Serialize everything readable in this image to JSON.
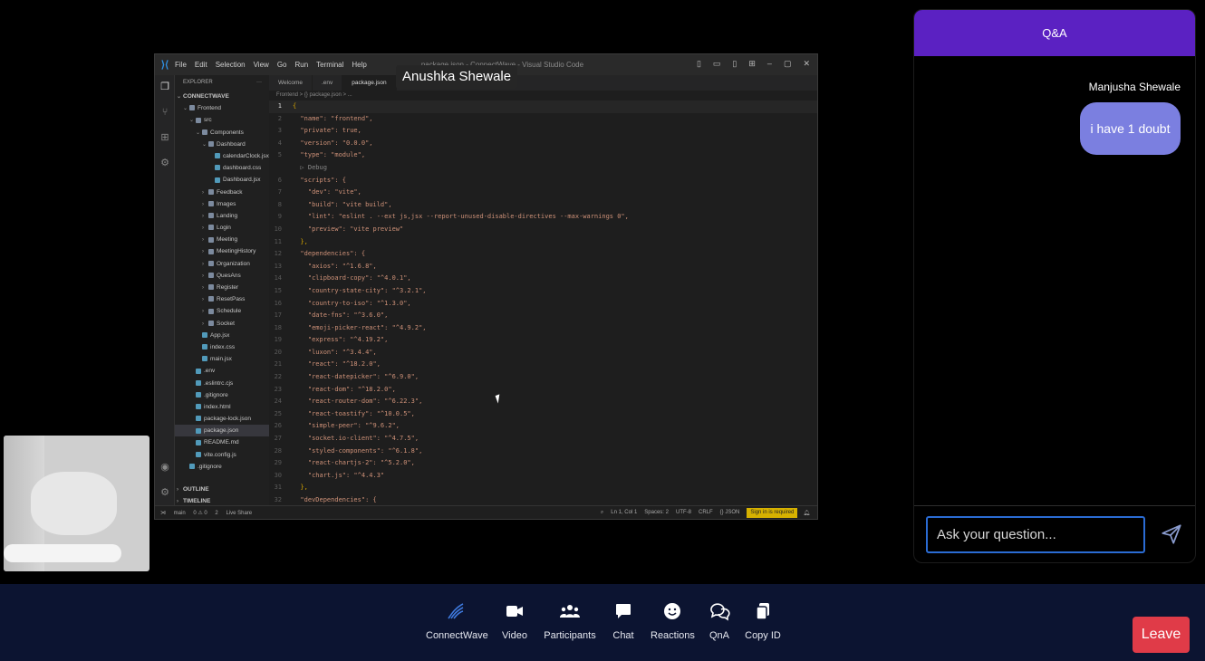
{
  "presenter": {
    "name": "Anushka Shewale"
  },
  "vscode": {
    "menu": [
      "File",
      "Edit",
      "Selection",
      "View",
      "Go",
      "Run",
      "Terminal",
      "Help"
    ],
    "window_title": "package.json - ConnectWave - Visual Studio Code",
    "explorer_title": "EXPLORER",
    "workspace": "CONNECTWAVE",
    "tree": [
      {
        "label": "Frontend",
        "depth": 1,
        "kind": "folder-open"
      },
      {
        "label": "src",
        "depth": 2,
        "kind": "folder-open"
      },
      {
        "label": "Components",
        "depth": 3,
        "kind": "folder-open"
      },
      {
        "label": "Dashboard",
        "depth": 4,
        "kind": "folder-open"
      },
      {
        "label": "calendarClock.jsx",
        "depth": 5,
        "kind": "file"
      },
      {
        "label": "dashboard.css",
        "depth": 5,
        "kind": "file"
      },
      {
        "label": "Dashboard.jsx",
        "depth": 5,
        "kind": "file"
      },
      {
        "label": "Feedback",
        "depth": 4,
        "kind": "folder"
      },
      {
        "label": "Images",
        "depth": 4,
        "kind": "folder"
      },
      {
        "label": "Landing",
        "depth": 4,
        "kind": "folder"
      },
      {
        "label": "Login",
        "depth": 4,
        "kind": "folder"
      },
      {
        "label": "Meeting",
        "depth": 4,
        "kind": "folder"
      },
      {
        "label": "MeetingHistory",
        "depth": 4,
        "kind": "folder"
      },
      {
        "label": "Organization",
        "depth": 4,
        "kind": "folder"
      },
      {
        "label": "QuesAns",
        "depth": 4,
        "kind": "folder"
      },
      {
        "label": "Register",
        "depth": 4,
        "kind": "folder"
      },
      {
        "label": "ResetPass",
        "depth": 4,
        "kind": "folder"
      },
      {
        "label": "Schedule",
        "depth": 4,
        "kind": "folder"
      },
      {
        "label": "Socket",
        "depth": 4,
        "kind": "folder"
      },
      {
        "label": "App.jsx",
        "depth": 3,
        "kind": "file"
      },
      {
        "label": "index.css",
        "depth": 3,
        "kind": "file"
      },
      {
        "label": "main.jsx",
        "depth": 3,
        "kind": "file"
      },
      {
        "label": ".env",
        "depth": 2,
        "kind": "file"
      },
      {
        "label": ".eslintrc.cjs",
        "depth": 2,
        "kind": "file"
      },
      {
        "label": ".gitignore",
        "depth": 2,
        "kind": "file"
      },
      {
        "label": "index.html",
        "depth": 2,
        "kind": "file"
      },
      {
        "label": "package-lock.json",
        "depth": 2,
        "kind": "file"
      },
      {
        "label": "package.json",
        "depth": 2,
        "kind": "file",
        "selected": true
      },
      {
        "label": "README.md",
        "depth": 2,
        "kind": "file"
      },
      {
        "label": "vite.config.js",
        "depth": 2,
        "kind": "file"
      },
      {
        "label": ".gitignore",
        "depth": 1,
        "kind": "file"
      }
    ],
    "outline": "OUTLINE",
    "timeline": "TIMELINE",
    "tabs": [
      "Welcome",
      ".env",
      "package.json"
    ],
    "breadcrumb": "Frontend > {} package.json > ...",
    "code": [
      "{",
      "  \"name\": \"frontend\",",
      "  \"private\": true,",
      "  \"version\": \"0.0.0\",",
      "  \"type\": \"module\",",
      "  ▷ Debug",
      "  \"scripts\": {",
      "    \"dev\": \"vite\",",
      "    \"build\": \"vite build\",",
      "    \"lint\": \"eslint . --ext js,jsx --report-unused-disable-directives --max-warnings 0\",",
      "    \"preview\": \"vite preview\"",
      "  },",
      "  \"dependencies\": {",
      "    \"axios\": \"^1.6.8\",",
      "    \"clipboard-copy\": \"^4.0.1\",",
      "    \"country-state-city\": \"^3.2.1\",",
      "    \"country-to-iso\": \"^1.3.0\",",
      "    \"date-fns\": \"^3.6.0\",",
      "    \"emoji-picker-react\": \"^4.9.2\",",
      "    \"express\": \"^4.19.2\",",
      "    \"luxon\": \"^3.4.4\",",
      "    \"react\": \"^18.2.0\",",
      "    \"react-datepicker\": \"^6.9.0\",",
      "    \"react-dom\": \"^18.2.0\",",
      "    \"react-router-dom\": \"^6.22.3\",",
      "    \"react-toastify\": \"^10.0.5\",",
      "    \"simple-peer\": \"^9.6.2\",",
      "    \"socket.io-client\": \"^4.7.5\",",
      "    \"styled-components\": \"^6.1.8\",",
      "    \"react-chartjs-2\": \"^5.2.0\",",
      "    \"chart.js\": \"^4.4.3\"",
      "  },",
      "  \"devDependencies\": {"
    ],
    "line_numbers": [
      "1",
      "2",
      "3",
      "4",
      "5",
      "",
      "6",
      "7",
      "8",
      "9",
      "10",
      "11",
      "12",
      "13",
      "14",
      "15",
      "16",
      "17",
      "18",
      "19",
      "20",
      "21",
      "22",
      "23",
      "24",
      "25",
      "26",
      "27",
      "28",
      "29",
      "30",
      "31",
      "32"
    ],
    "status_left": [
      "main",
      "0 ⚠ 0",
      "2",
      "Live Share"
    ],
    "status_right": [
      "Ln 1, Col 1",
      "Spaces: 2",
      "UTF-8",
      "CRLF",
      "{} JSON"
    ],
    "status_warning": "Sign in is required"
  },
  "qa": {
    "title": "Q&A",
    "messages": [
      {
        "author": "Manjusha Shewale",
        "text": "i have 1 doubt"
      }
    ],
    "input_placeholder": "Ask your question..."
  },
  "toolbar": {
    "brand_label": "ConnectWave",
    "video_label": "Video",
    "participants_label": "Participants",
    "chat_label": "Chat",
    "reactions_label": "Reactions",
    "qna_label": "QnA",
    "copy_id_label": "Copy ID",
    "leave_label": "Leave",
    "leave_color": "#e03b48",
    "bar_color": "#0c1431"
  },
  "colors": {
    "qa_header": "#5b21c2",
    "bubble": "#7b7fe0",
    "input_border": "#2b6cd4"
  }
}
